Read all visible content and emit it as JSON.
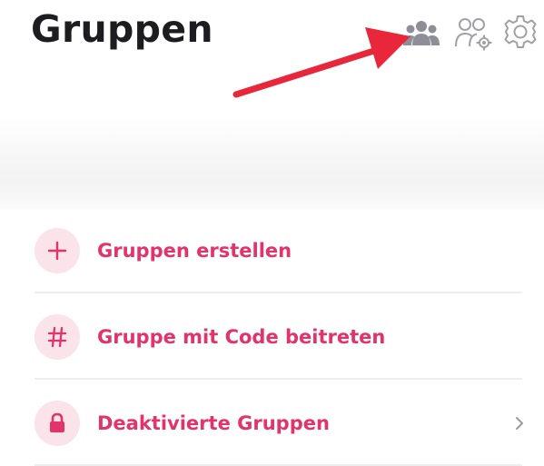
{
  "header": {
    "title": "Gruppen",
    "icons": [
      "groups-icon",
      "group-settings-icon",
      "gear-icon"
    ]
  },
  "colors": {
    "accent": "#e2336b",
    "accent_bg": "#fbe3ea",
    "title": "#1c1c21",
    "icon_gray": "#8e8e98",
    "annotation_arrow": "#e8283a"
  },
  "menu": {
    "items": [
      {
        "label": "Gruppen erstellen",
        "icon": "plus-icon"
      },
      {
        "label": "Gruppe mit Code beitreten",
        "icon": "hash-icon"
      },
      {
        "label": "Deaktivierte Gruppen",
        "icon": "lock-icon",
        "chevron": "chevron-right-icon"
      }
    ]
  }
}
